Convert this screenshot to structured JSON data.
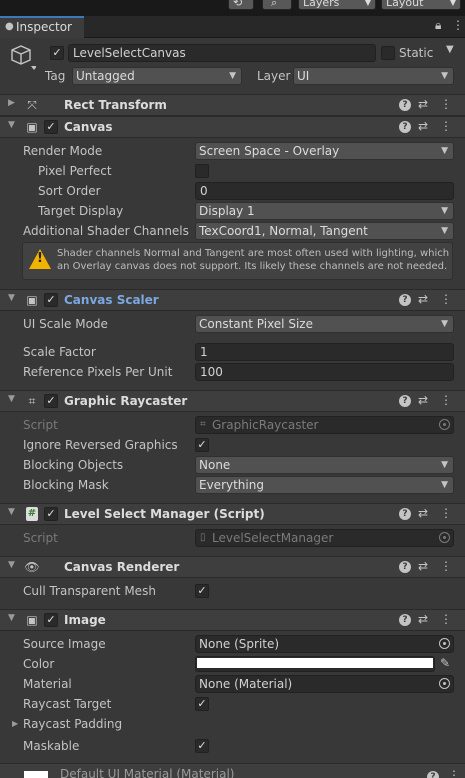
{
  "toolbar": {
    "layers_label": "Layers",
    "layout_label": "Layout"
  },
  "tab": {
    "label": "Inspector"
  },
  "object": {
    "name": "LevelSelectCanvas",
    "active": true,
    "static_label": "Static",
    "static": false,
    "tag_label": "Tag",
    "tag_value": "Untagged",
    "layer_label": "Layer",
    "layer_value": "UI"
  },
  "components": {
    "rect_transform": {
      "title": "Rect Transform"
    },
    "canvas": {
      "title": "Canvas",
      "enabled": true,
      "render_mode_label": "Render Mode",
      "render_mode": "Screen Space - Overlay",
      "pixel_perfect_label": "Pixel Perfect",
      "pixel_perfect": false,
      "sort_order_label": "Sort Order",
      "sort_order": "0",
      "target_display_label": "Target Display",
      "target_display": "Display 1",
      "shader_channels_label": "Additional Shader Channels",
      "shader_channels": "TexCoord1, Normal, Tangent",
      "warning": "Shader channels Normal and Tangent are most often used with lighting, which an Overlay canvas does not support. Its likely these channels are not needed."
    },
    "canvas_scaler": {
      "title": "Canvas Scaler",
      "enabled": true,
      "ui_scale_mode_label": "UI Scale Mode",
      "ui_scale_mode": "Constant Pixel Size",
      "scale_factor_label": "Scale Factor",
      "scale_factor": "1",
      "ref_pixels_label": "Reference Pixels Per Unit",
      "ref_pixels": "100"
    },
    "graphic_raycaster": {
      "title": "Graphic Raycaster",
      "enabled": true,
      "script_label": "Script",
      "script_value": "GraphicRaycaster",
      "ignore_reversed_label": "Ignore Reversed Graphics",
      "ignore_reversed": true,
      "blocking_objects_label": "Blocking Objects",
      "blocking_objects": "None",
      "blocking_mask_label": "Blocking Mask",
      "blocking_mask": "Everything"
    },
    "level_select_manager": {
      "title": "Level Select Manager (Script)",
      "enabled": true,
      "script_label": "Script",
      "script_value": "LevelSelectManager"
    },
    "canvas_renderer": {
      "title": "Canvas Renderer",
      "cull_label": "Cull Transparent Mesh",
      "cull": true
    },
    "image": {
      "title": "Image",
      "enabled": true,
      "source_image_label": "Source Image",
      "source_image": "None (Sprite)",
      "color_label": "Color",
      "color_value": "#ffffff",
      "material_label": "Material",
      "material": "None (Material)",
      "raycast_target_label": "Raycast Target",
      "raycast_target": true,
      "raycast_padding_label": "Raycast Padding",
      "maskable_label": "Maskable",
      "maskable": true
    }
  },
  "footer": {
    "material_label": "Default UI Material (Material)"
  },
  "icons": {
    "help": "?",
    "preset": "⇄",
    "more": "⋮",
    "check": "✓"
  }
}
